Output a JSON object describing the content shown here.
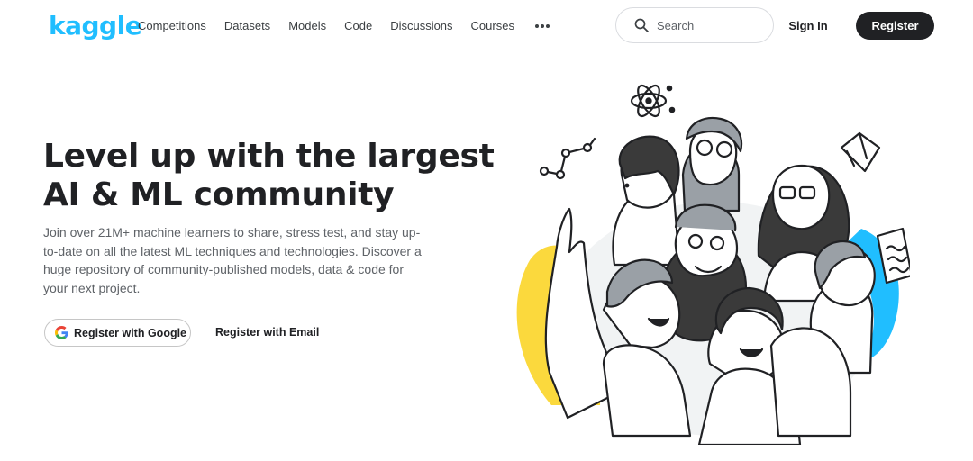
{
  "brand": {
    "logo_text": "kaggle",
    "accent_color": "#20beff"
  },
  "nav": {
    "items": [
      {
        "label": "Competitions"
      },
      {
        "label": "Datasets"
      },
      {
        "label": "Models"
      },
      {
        "label": "Code"
      },
      {
        "label": "Discussions"
      },
      {
        "label": "Courses"
      }
    ],
    "more_icon": "more-horizontal-icon"
  },
  "search": {
    "placeholder": "Search",
    "value": "",
    "icon": "search-icon"
  },
  "auth": {
    "sign_in_label": "Sign In",
    "register_label": "Register"
  },
  "hero": {
    "headline": "Level up with the largest AI & ML community",
    "description": "Join over 21M+ machine learners to share, stress test, and stay up-to-date on all the latest ML techniques and technologies. Discover a huge repository of community-published models, data & code for your next project.",
    "google_button_label": "Register with Google",
    "google_icon": "google-g-icon",
    "email_button_label": "Register with Email"
  },
  "colors": {
    "dark_button": "#202124",
    "illustration_yellow": "#fbd93d",
    "illustration_blue": "#20beff"
  }
}
